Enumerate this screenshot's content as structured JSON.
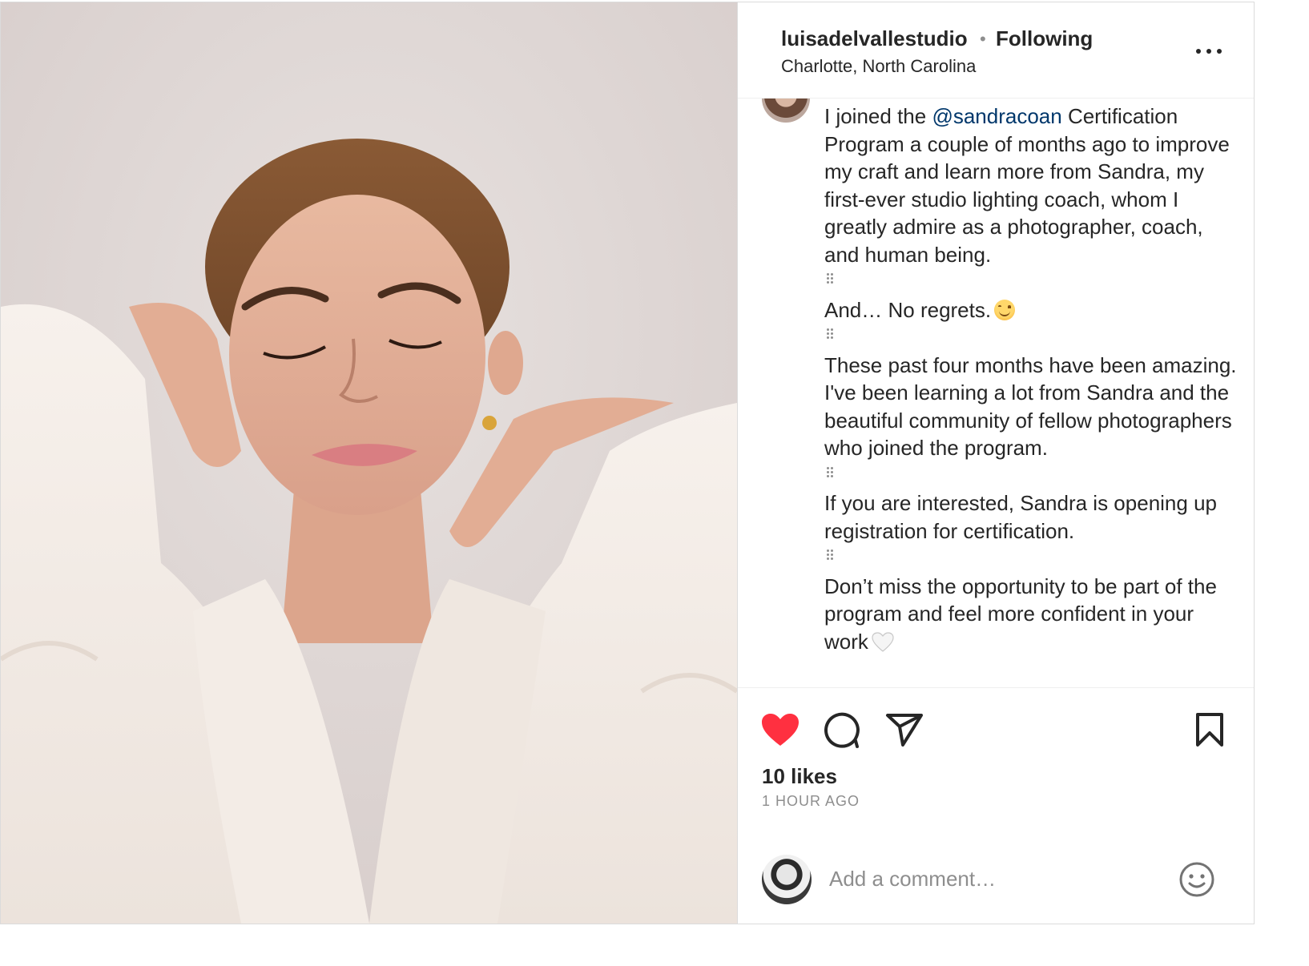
{
  "post": {
    "photo_alt": "",
    "header": {
      "username": "luisadelvallestudio",
      "separator": "•",
      "follow_status": "Following",
      "location": "Charlotte, North Carolina",
      "more_icon": "more-horizontal-icon"
    },
    "caption": {
      "line1_pre": "I joined the ",
      "mention": "@sandracoan",
      "line1_post": " Certification Program a couple of months ago to improve my craft and learn more from Sandra, my first-ever studio lighting coach, whom I greatly admire as a photographer, coach, and human being.",
      "para2": "And… No regrets.",
      "para3": "These past four months have been amazing. I've been learning a lot from Sandra and the beautiful community of fellow photographers who joined the program.",
      "para4": "If you are interested, Sandra is opening up registration for certification.",
      "para5": "Don’t miss the opportunity to be part of the program and feel more confident in your work"
    },
    "actions": {
      "like_icon": "heart-filled-icon",
      "comment_icon": "comment-bubble-icon",
      "share_icon": "paper-plane-icon",
      "save_icon": "bookmark-icon",
      "like_color": "#ff3040",
      "likes": "10 likes",
      "timestamp": "1 HOUR AGO"
    },
    "comment": {
      "placeholder": "Add a comment…",
      "emoji_icon": "smiley-icon"
    }
  }
}
